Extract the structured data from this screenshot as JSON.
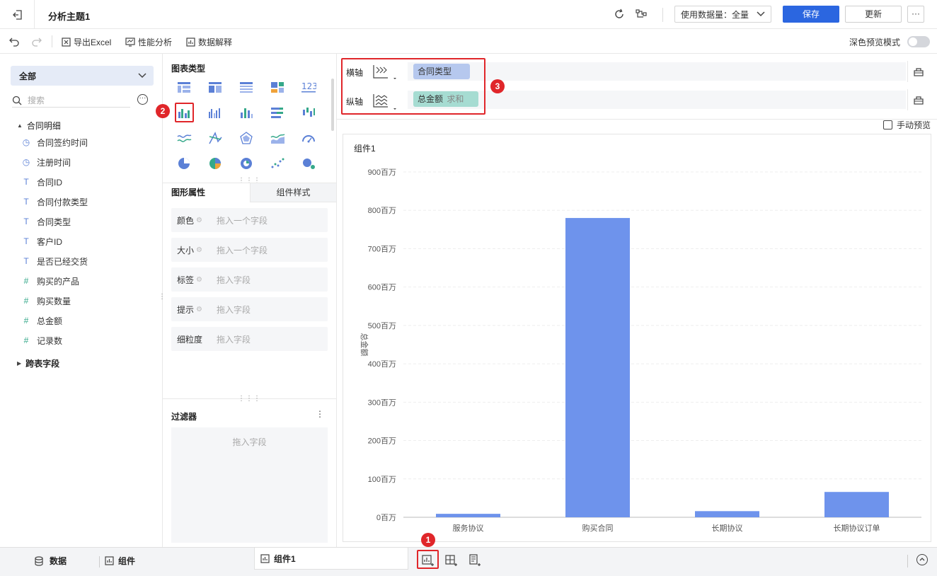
{
  "header": {
    "title": "分析主题1",
    "data_scope": "使用数据量：全量",
    "save_label": "保存",
    "update_label": "更新",
    "more_label": "···"
  },
  "toolbar": {
    "export_label": "导出Excel",
    "perf_label": "性能分析",
    "explain_label": "数据解释",
    "dark_mode_label": "深色预览模式"
  },
  "left_panel": {
    "scope_select": "全部",
    "search_placeholder": "搜索",
    "table_name": "合同明细",
    "fields": [
      {
        "name": "合同签约时间",
        "icon": "clock"
      },
      {
        "name": "注册时间",
        "icon": "clock"
      },
      {
        "name": "合同ID",
        "icon": "T"
      },
      {
        "name": "合同付款类型",
        "icon": "T"
      },
      {
        "name": "合同类型",
        "icon": "T"
      },
      {
        "name": "客户ID",
        "icon": "T"
      },
      {
        "name": "是否已经交货",
        "icon": "T"
      },
      {
        "name": "购买的产品",
        "icon": "#"
      },
      {
        "name": "购买数量",
        "icon": "#"
      },
      {
        "name": "总金额",
        "icon": "#"
      },
      {
        "name": "记录数",
        "icon": "#*"
      }
    ],
    "cross_table": "跨表字段"
  },
  "mid_panel": {
    "chart_types_title": "图表类型",
    "tab_graph_attr": "图形属性",
    "tab_widget_style": "组件样式",
    "props": [
      {
        "label": "颜色",
        "placeholder": "拖入一个字段"
      },
      {
        "label": "大小",
        "placeholder": "拖入一个字段"
      },
      {
        "label": "标签",
        "placeholder": "拖入字段"
      },
      {
        "label": "提示",
        "placeholder": "拖入字段"
      },
      {
        "label": "细粒度",
        "placeholder": "拖入字段"
      }
    ],
    "filter_title": "过滤器",
    "filter_placeholder": "拖入字段"
  },
  "axes": {
    "x_label": "横轴",
    "y_label": "纵轴",
    "x_field": "合同类型",
    "y_field": "总金额",
    "y_agg": "求和",
    "manual_preview": "手动预览"
  },
  "widget": {
    "title": "组件1"
  },
  "chart_data": {
    "type": "bar",
    "categories": [
      "服务协议",
      "购买合同",
      "长期协议",
      "长期协议订单"
    ],
    "values": [
      9,
      780,
      16,
      66
    ],
    "ylabel": "总金额",
    "y_ticks": [
      "0百万",
      "100百万",
      "200百万",
      "300百万",
      "400百万",
      "500百万",
      "600百万",
      "700百万",
      "800百万",
      "900百万"
    ],
    "ylim": [
      0,
      900
    ],
    "unit": "百万",
    "bar_color": "#6e93ec",
    "grid": true
  },
  "bottom": {
    "data_tab": "数据",
    "widget_tab": "组件",
    "active_tab": "组件1"
  },
  "annotations": [
    "1",
    "2",
    "3"
  ]
}
